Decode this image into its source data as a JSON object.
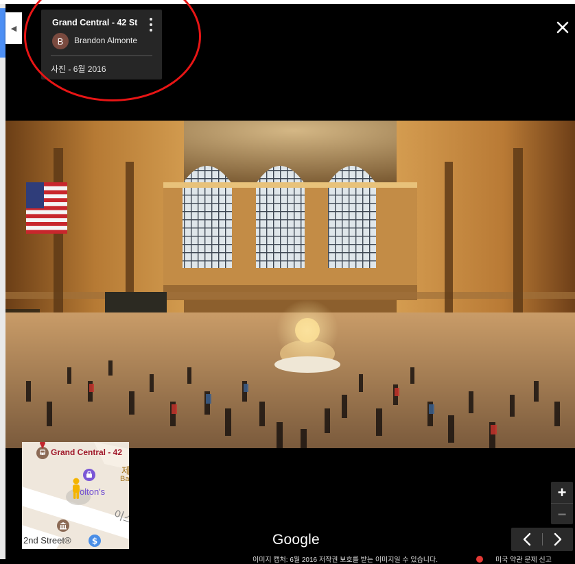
{
  "viewer": {
    "collapse_icon": "◀",
    "close_icon": "close-icon"
  },
  "info_card": {
    "title": "Grand Central - 42 St",
    "author_initial": "B",
    "author_name": "Brandon Almonte",
    "photo_date": "사진 - 6월 2016",
    "more_icon": "more-vertical-icon"
  },
  "mini_map": {
    "station_label": "Grand Central - 42",
    "korean_label_1": "제",
    "korean_label_b": "Ba",
    "store_label": "olton's",
    "korean_label_2": "이스",
    "street_label": "2nd Street®",
    "icons": [
      "subway-icon",
      "shopping-bag-icon",
      "pegman-icon",
      "bank-icon",
      "dollar-icon"
    ]
  },
  "branding": {
    "logo_text": "Google"
  },
  "footer": {
    "caption": "이미지 캡처: 6월 2016    저작권 보호를 받는 이미지일 수 있습니다.",
    "links": "미국    약관    문제 신고"
  },
  "controls": {
    "zoom_in": "+",
    "zoom_out": "−",
    "prev": "prev-arrow-icon",
    "next": "next-arrow-icon"
  },
  "colors": {
    "card_bg": "#262626",
    "annotation_ring": "#e81515",
    "map_label_red": "#a0182a",
    "accent_blue": "#4d8ff4"
  }
}
